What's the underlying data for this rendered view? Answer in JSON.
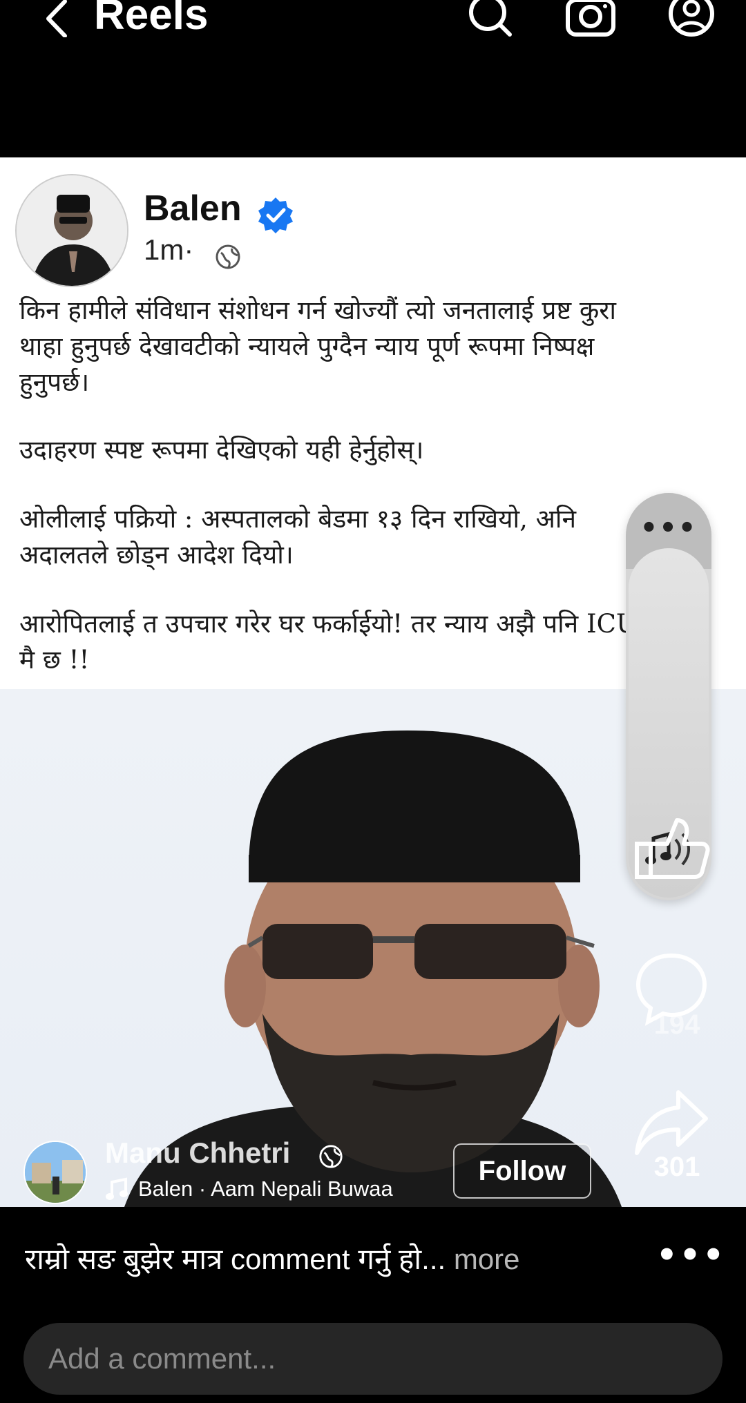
{
  "header": {
    "title": "Reels",
    "icons": [
      "back-icon",
      "search-icon",
      "camera-icon",
      "profile-icon"
    ]
  },
  "post": {
    "author": "Balen",
    "time": "1m·",
    "paragraphs": [
      "किन हामीले संविधान संशोधन गर्न खोज्यौं त्यो जनतालाई प्रष्ट कुरा थाहा हुनुपर्छ देखावटीको न्यायले पुग्दैन न्याय पूर्ण रूपमा निष्पक्ष हुनुपर्छ।",
      "उदाहरण स्पष्ट रूपमा देखिएको यही हेर्नुहोस्।",
      "ओलीलाई पक्रियो : अस्पतालको बेडमा १३ दिन राखियो, अनि अदालतले छोड्न आदेश दियो।",
      "आरोपितलाई त उपचार गरेर घर फर्काईयो! तर न्याय अझै पनि ICU मै छ !!"
    ]
  },
  "rail": {
    "menu_dots": "•••",
    "comments_count": "194",
    "shares_count": "301"
  },
  "reel_author": {
    "name": "Manu Chhetri",
    "audio": "Balen · Aam Nepali Buwaa",
    "follow_label": "Follow"
  },
  "caption": {
    "text": "राम्रो सङ बुझेर मात्र comment गर्नु हो...",
    "more": " more",
    "dots": "•••"
  },
  "comment": {
    "placeholder": "Add a comment..."
  },
  "colors": {
    "background": "#000000",
    "verified_blue": "#1877f2",
    "comment_box": "#262626"
  }
}
